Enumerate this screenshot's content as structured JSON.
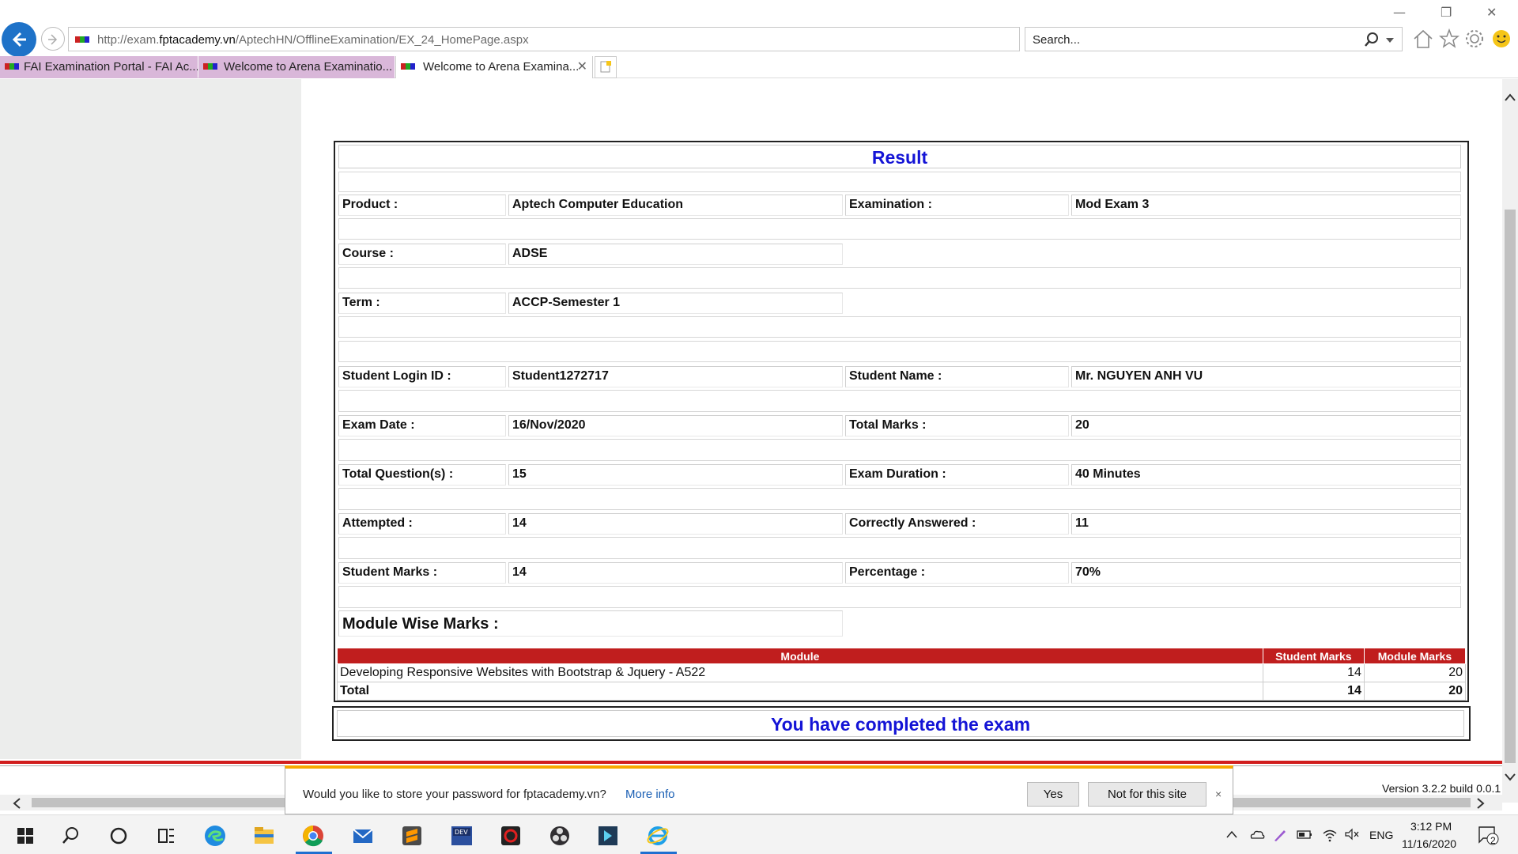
{
  "browser": {
    "url_prefix": "http://exam.",
    "url_domain": "fptacademy.vn",
    "url_path": "/AptechHN/OfflineExamination/EX_24_HomePage.aspx",
    "search_placeholder": "Search...",
    "tabs": [
      {
        "label": "FAI Examination Portal - FAI Ac...",
        "active": false
      },
      {
        "label": "Welcome to Arena Examinatio...",
        "active": false
      },
      {
        "label": "Welcome to Arena Examina...",
        "active": true
      }
    ]
  },
  "result": {
    "title": "Result",
    "rows": {
      "product_label": "Product :",
      "product_value": "Aptech Computer Education",
      "examination_label": "Examination :",
      "examination_value": "Mod Exam 3",
      "course_label": "Course :",
      "course_value": "ADSE",
      "term_label": "Term :",
      "term_value": "ACCP-Semester 1",
      "login_label": "Student Login ID :",
      "login_value": "Student1272717",
      "name_label": "Student Name :",
      "name_value": "Mr. NGUYEN ANH VU",
      "date_label": "Exam Date :",
      "date_value": "16/Nov/2020",
      "total_marks_label": "Total Marks :",
      "total_marks_value": "20",
      "questions_label": "Total Question(s) :",
      "questions_value": "15",
      "duration_label": "Exam Duration :",
      "duration_value": "40 Minutes",
      "attempted_label": "Attempted :",
      "attempted_value": "14",
      "correct_label": "Correctly Answered :",
      "correct_value": "11",
      "student_marks_label": "Student Marks :",
      "student_marks_value": "14",
      "percentage_label": "Percentage :",
      "percentage_value": "70%"
    },
    "module_heading": "Module Wise Marks :",
    "module_table": {
      "headers": [
        "Module",
        "Student Marks",
        "Module Marks"
      ],
      "row": {
        "module": "Developing Responsive Websites with Bootstrap & Jquery - A522",
        "student_marks": "14",
        "module_marks": "20"
      },
      "total": {
        "label": "Total",
        "student_marks": "14",
        "module_marks": "20"
      }
    },
    "completed_message": "You have completed the exam"
  },
  "footer": {
    "version": "Version 3.2.2 build 0.0.1"
  },
  "password_bar": {
    "message": "Would you like to store your password for fptacademy.vn?",
    "more_info": "More info",
    "yes": "Yes",
    "not_for_site": "Not for this site",
    "close": "×"
  },
  "taskbar": {
    "time": "3:12 PM",
    "date": "11/16/2020",
    "language": "ENG",
    "notification_count": "2"
  },
  "colors": {
    "accent_blue": "#1414d6",
    "header_red": "#c01e1e",
    "tab_inactive": "#d9b7d9",
    "warning_bar": "#f7a800"
  }
}
